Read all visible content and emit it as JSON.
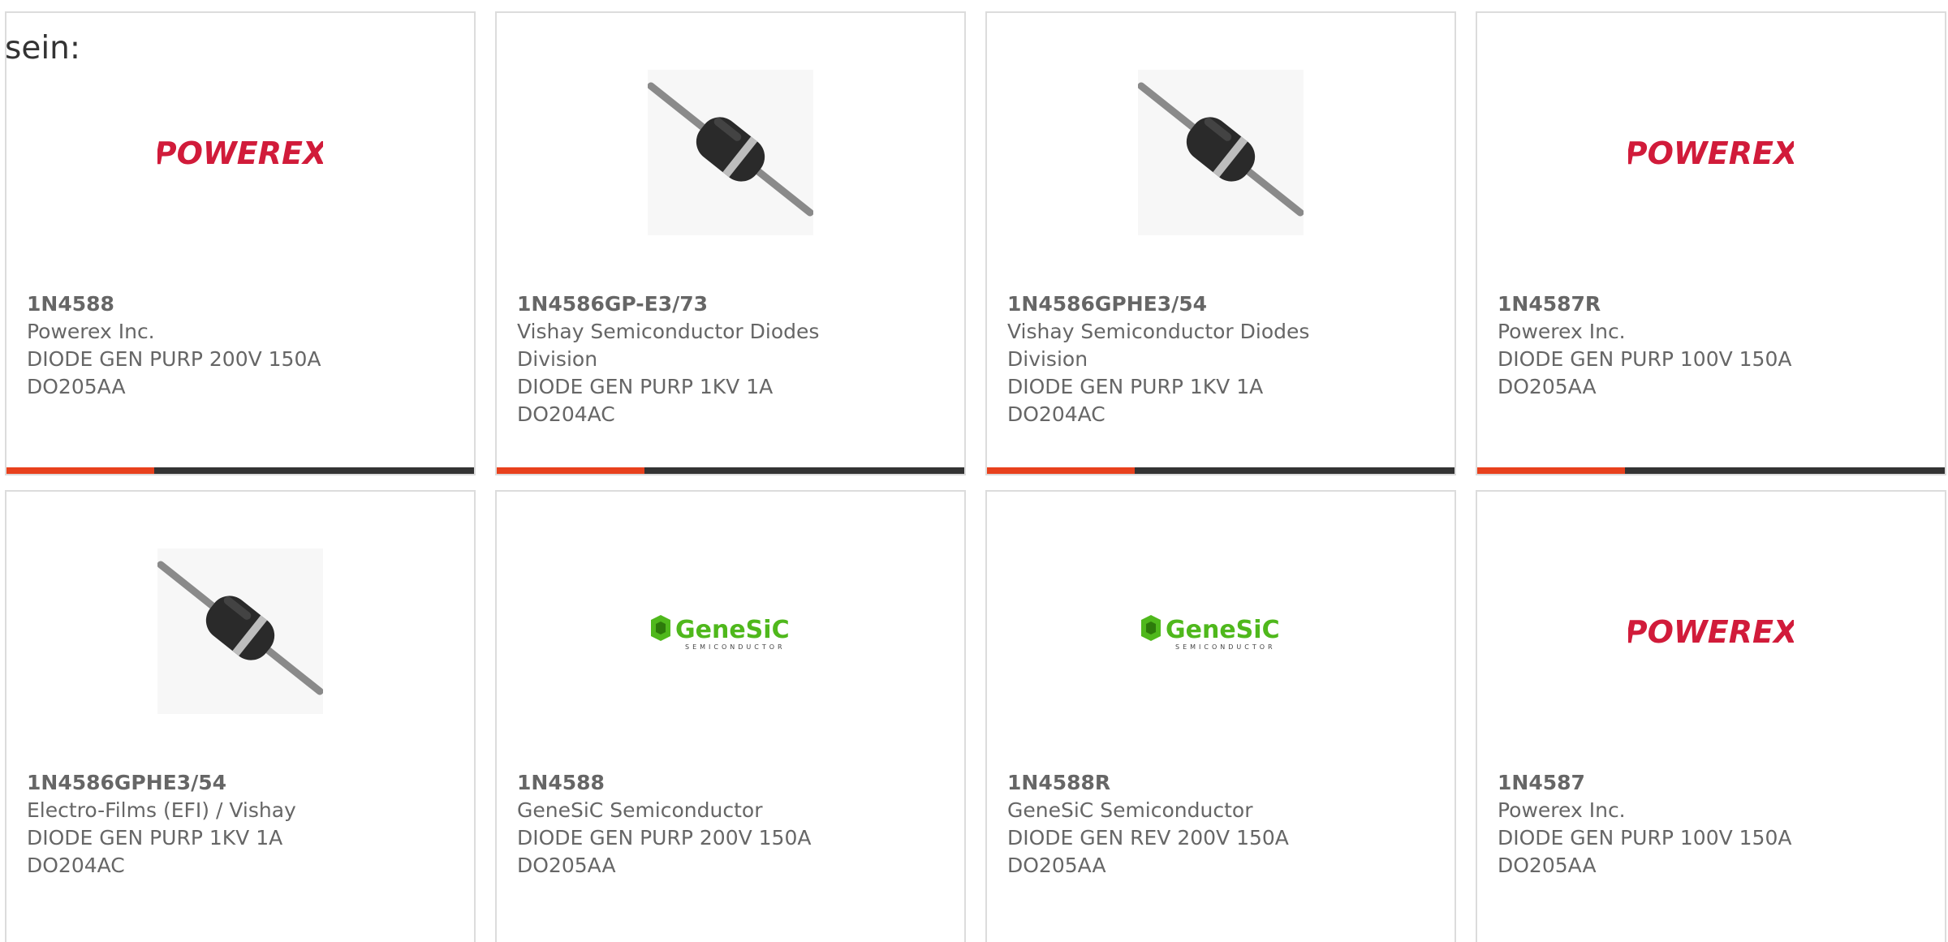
{
  "intro_text": "sein:",
  "colors": {
    "accent_bar": "#e8411d",
    "dark_bar": "#333333",
    "powerex_red": "#d11b3a",
    "genesic_green": "#4fb81c"
  },
  "products": [
    {
      "part_number": "1N4588",
      "manufacturer": "Powerex Inc.",
      "description": "DIODE GEN PURP 200V 150A",
      "package": "DO205AA",
      "image": "powerex-logo",
      "logo_text": "POWEREX"
    },
    {
      "part_number": "1N4586GP-E3/73",
      "manufacturer": "Vishay Semiconductor Diodes Division",
      "description": "DIODE GEN PURP 1KV 1A",
      "package": "DO204AC",
      "image": "axial-diode-photo"
    },
    {
      "part_number": "1N4586GPHE3/54",
      "manufacturer": "Vishay Semiconductor Diodes Division",
      "description": "DIODE GEN PURP 1KV 1A",
      "package": "DO204AC",
      "image": "axial-diode-photo"
    },
    {
      "part_number": "1N4587R",
      "manufacturer": "Powerex Inc.",
      "description": "DIODE GEN PURP 100V 150A",
      "package": "DO205AA",
      "image": "powerex-logo",
      "logo_text": "POWEREX"
    },
    {
      "part_number": "1N4586GPHE3/54",
      "manufacturer": "Electro-Films (EFI) / Vishay",
      "description": "DIODE GEN PURP 1KV 1A",
      "package": "DO204AC",
      "image": "axial-diode-photo"
    },
    {
      "part_number": "1N4588",
      "manufacturer": "GeneSiC Semiconductor",
      "description": "DIODE GEN PURP 200V 150A",
      "package": "DO205AA",
      "image": "genesic-logo",
      "logo_text": "GeneSiC",
      "logo_subtext": "SEMICONDUCTOR"
    },
    {
      "part_number": "1N4588R",
      "manufacturer": "GeneSiC Semiconductor",
      "description": "DIODE GEN REV 200V 150A",
      "package": "DO205AA",
      "image": "genesic-logo",
      "logo_text": "GeneSiC",
      "logo_subtext": "SEMICONDUCTOR"
    },
    {
      "part_number": "1N4587",
      "manufacturer": "Powerex Inc.",
      "description": "DIODE GEN PURP 100V 150A",
      "package": "DO205AA",
      "image": "powerex-logo",
      "logo_text": "POWEREX"
    }
  ]
}
